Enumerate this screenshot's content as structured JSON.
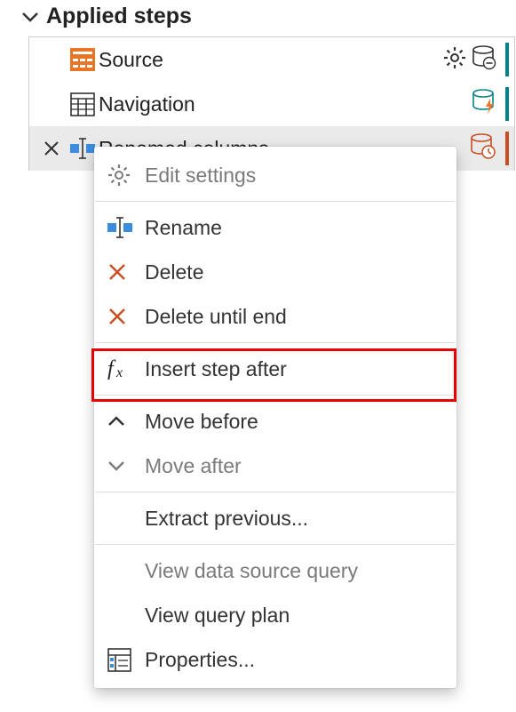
{
  "header": {
    "title": "Applied steps"
  },
  "steps": [
    {
      "id": "source",
      "label": "Source",
      "right1": "gear",
      "right2": "db-minus",
      "accent": "teal"
    },
    {
      "id": "nav",
      "label": "Navigation",
      "right1": null,
      "right2": "db-bolt",
      "accent": "teal"
    },
    {
      "id": "rename",
      "label": "Renamed columns",
      "right1": null,
      "right2": "db-clock",
      "accent": "orange",
      "selected": true,
      "deletable": true
    }
  ],
  "menu": {
    "edit_settings": "Edit settings",
    "rename": "Rename",
    "delete": "Delete",
    "delete_until_end": "Delete until end",
    "insert_step_after": "Insert step after",
    "move_before": "Move before",
    "move_after": "Move after",
    "extract_previous": "Extract previous...",
    "view_data_source_query": "View data source query",
    "view_query_plan": "View query plan",
    "properties": "Properties..."
  }
}
